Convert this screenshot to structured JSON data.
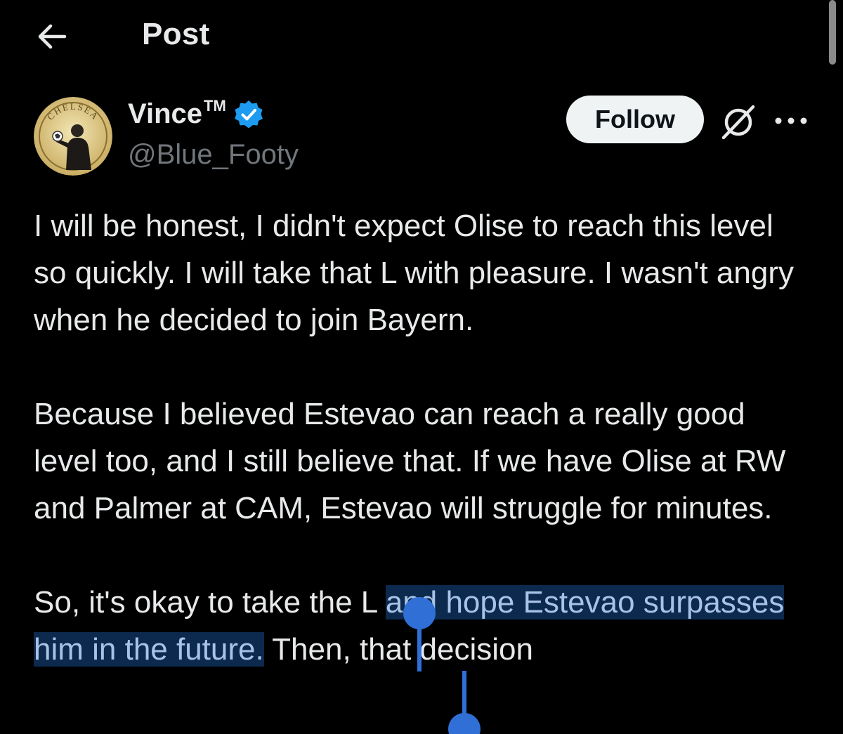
{
  "header": {
    "title": "Post",
    "back_icon": "arrow-left-icon"
  },
  "author": {
    "display_name": "Vince",
    "tm": "TM",
    "handle": "@Blue_Footy",
    "verified": true,
    "avatar_badge_text": "CHELSEA"
  },
  "actions": {
    "follow_label": "Follow",
    "grok_icon": "grok-icon",
    "more_icon": "more-horizontal-icon"
  },
  "post": {
    "paragraph1": "I will be honest, I didn't expect Olise to reach this level so quickly. I will take that L with pleasure. I wasn't angry when he decided to join Bayern.",
    "paragraph2": "Because I believed Estevao can reach a really good level too, and I still believe that. If we have Olise at RW and Palmer at CAM, Estevao will struggle for minutes.",
    "paragraph3_before": "So, it's okay to take the L ",
    "paragraph3_selected": "and hope Estevao surpasses him in the future.",
    "paragraph3_after": " Then, that decision"
  },
  "colors": {
    "background": "#000000",
    "text": "#e7e9ea",
    "muted": "#71767b",
    "verified": "#1d9bf0",
    "selection_bg": "#0c2a4d",
    "selection_handle": "#2f6fd6"
  }
}
